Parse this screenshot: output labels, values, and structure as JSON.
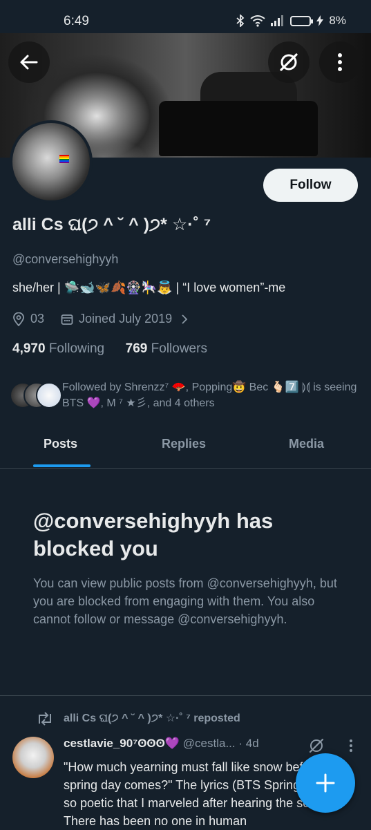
{
  "status_bar": {
    "time": "6:49",
    "battery": "8%",
    "icons": [
      "bluetooth-icon",
      "wifi-icon",
      "signal-icon",
      "battery-icon",
      "charging-icon"
    ]
  },
  "header": {
    "back_icon": "arrow-left-icon",
    "grok_icon": "grok-icon",
    "more_icon": "more-vertical-icon"
  },
  "profile": {
    "follow_label": "Follow",
    "name": "alli Cs ଘ(੭ ^ ˘ ^ )੭* ☆·˚ ⁷",
    "handle": "@conversehighyyh",
    "bio": "she/her | 🛸🐋🦋🍂🎡🎠👼 | “I love women”-me",
    "location": "03",
    "joined": "Joined July 2019",
    "following_count": "4,970",
    "following_label": "Following",
    "followers_count": "769",
    "followers_label": "Followers",
    "followed_by": "Followed by Shrenzz⁷ 🪭, Popping🤠 Bec 🫰🏻7️⃣ ⟭⟬ is seeing BTS 💜, M ⁷ ★彡, and 4 others"
  },
  "tabs": [
    {
      "label": "Posts",
      "active": true
    },
    {
      "label": "Replies",
      "active": false
    },
    {
      "label": "Media",
      "active": false
    }
  ],
  "blocked": {
    "title": "@conversehighyyh has blocked you",
    "message": "You can view public posts from @conversehighyyh, but you are blocked from engaging with them. You also cannot follow or message @conversehighyyh."
  },
  "post": {
    "repost_label": "alli Cs ଘ(੭ ^ ˘ ^ )੭* ☆·˚ ⁷ reposted",
    "author": "cestlavie_90⁷ʘʘʘ💜",
    "author_handle": "@cestla...",
    "time": "· 4d",
    "text": "\"How much yearning must fall like snow before that spring day comes?\" The lyrics (BTS Spring Day) are so poetic that I marveled after hearing the song. There has been no one in human"
  },
  "colors": {
    "background": "#15202b",
    "accent": "#1d9bf0",
    "text": "#e7e9ea",
    "muted": "#8b98a5"
  }
}
